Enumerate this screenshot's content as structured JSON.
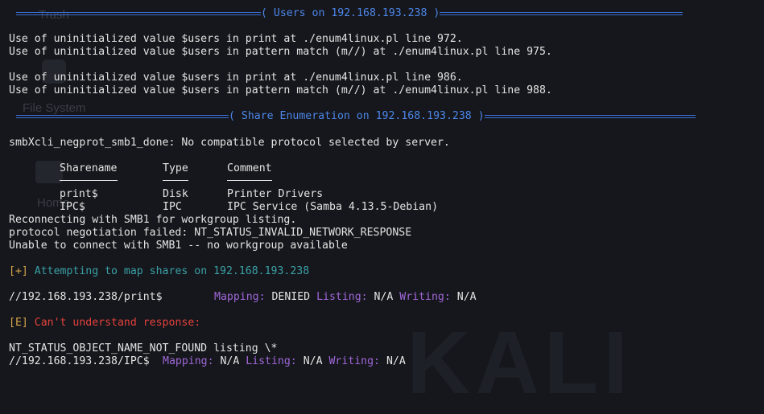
{
  "colors": {
    "background": "#15171c",
    "text": "#e4e4e4",
    "banner": "#4d86e8",
    "label_purple": "#a067d8",
    "info_amber": "#d7a54a",
    "info_cyan": "#3aa0a6",
    "error_red": "#e5413c"
  },
  "desktop": {
    "trash_label": "Trash",
    "filesystem_label": "File System",
    "home_label": "Home",
    "logo_text": "KALI"
  },
  "terminal": {
    "users_banner": "( Users on 192.168.193.238 )",
    "users_warnings": [
      "Use of uninitialized value $users in print at ./enum4linux.pl line 972.",
      "Use of uninitialized value $users in pattern match (m//) at ./enum4linux.pl line 975.",
      "Use of uninitialized value $users in print at ./enum4linux.pl line 986.",
      "Use of uninitialized value $users in pattern match (m//) at ./enum4linux.pl line 988."
    ],
    "share_banner": "( Share Enumeration on 192.168.193.238 )",
    "negprot_line": "smbXcli_negprot_smb1_done: No compatible protocol selected by server.",
    "share_table": {
      "headers": [
        "Sharename",
        "Type",
        "Comment"
      ],
      "rows": [
        [
          "print$",
          "Disk",
          "Printer Drivers"
        ],
        [
          "IPC$",
          "IPC",
          "IPC Service (Samba 4.13.5-Debian)"
        ]
      ]
    },
    "reconnect_lines": [
      "Reconnecting with SMB1 for workgroup listing.",
      "protocol negotiation failed: NT_STATUS_INVALID_NETWORK_RESPONSE",
      "Unable to connect with SMB1 -- no workgroup available"
    ],
    "attempt_prefix": "[+]",
    "attempt_text": " Attempting to map shares on 192.168.193.238",
    "print_share": {
      "path": "//192.168.193.238/print$",
      "mapping_label": "Mapping:",
      "mapping_value": " DENIED ",
      "listing_label": "Listing:",
      "listing_value": " N/A ",
      "writing_label": "Writing:",
      "writing_value": " N/A"
    },
    "error_prefix": "[E]",
    "error_text": " Can't understand response:",
    "not_found_line": "NT_STATUS_OBJECT_NAME_NOT_FOUND listing \\*",
    "ipc_share": {
      "path": "//192.168.193.238/IPC$",
      "mapping_label": "Mapping:",
      "mapping_value": " N/A ",
      "listing_label": "Listing:",
      "listing_value": " N/A ",
      "writing_label": "Writing:",
      "writing_value": " N/A"
    }
  }
}
